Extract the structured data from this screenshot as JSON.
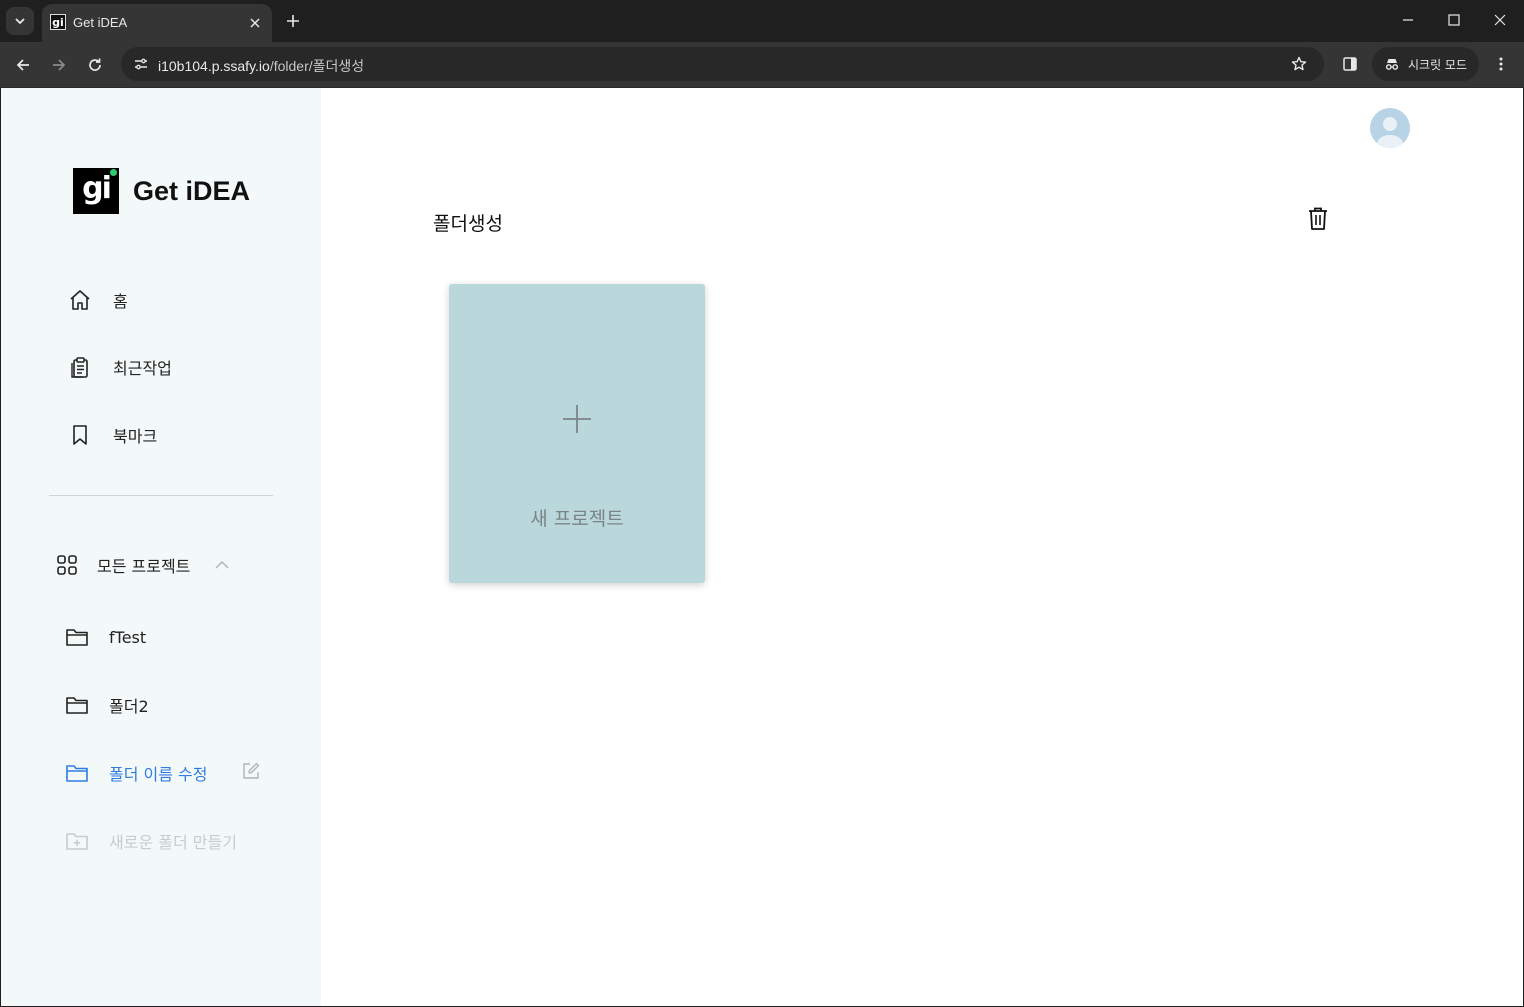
{
  "browser": {
    "tab_title": "Get iDEA",
    "favicon_text": "gi",
    "url_host": "i10b104.p.ssafy.io",
    "url_path": "/folder/폴더생성",
    "incognito_label": "시크릿 모드"
  },
  "sidebar": {
    "logo_mark": "gi",
    "logo_text": "Get iDEA",
    "nav": [
      {
        "label": "홈",
        "icon": "home-icon"
      },
      {
        "label": "최근작업",
        "icon": "clipboard-icon"
      },
      {
        "label": "북마크",
        "icon": "bookmark-icon"
      }
    ],
    "all_projects_label": "모든 프로젝트",
    "folders": [
      {
        "label": "fTest",
        "state": "normal"
      },
      {
        "label": "폴더2",
        "state": "normal"
      },
      {
        "label": "폴더 이름 수정",
        "state": "active"
      }
    ],
    "new_folder_label": "새로운 폴더 만들기",
    "active_color": "#2f7de1"
  },
  "main": {
    "title": "폴더생성",
    "new_project_label": "새 프로젝트",
    "card_color": "#bad8dc"
  }
}
